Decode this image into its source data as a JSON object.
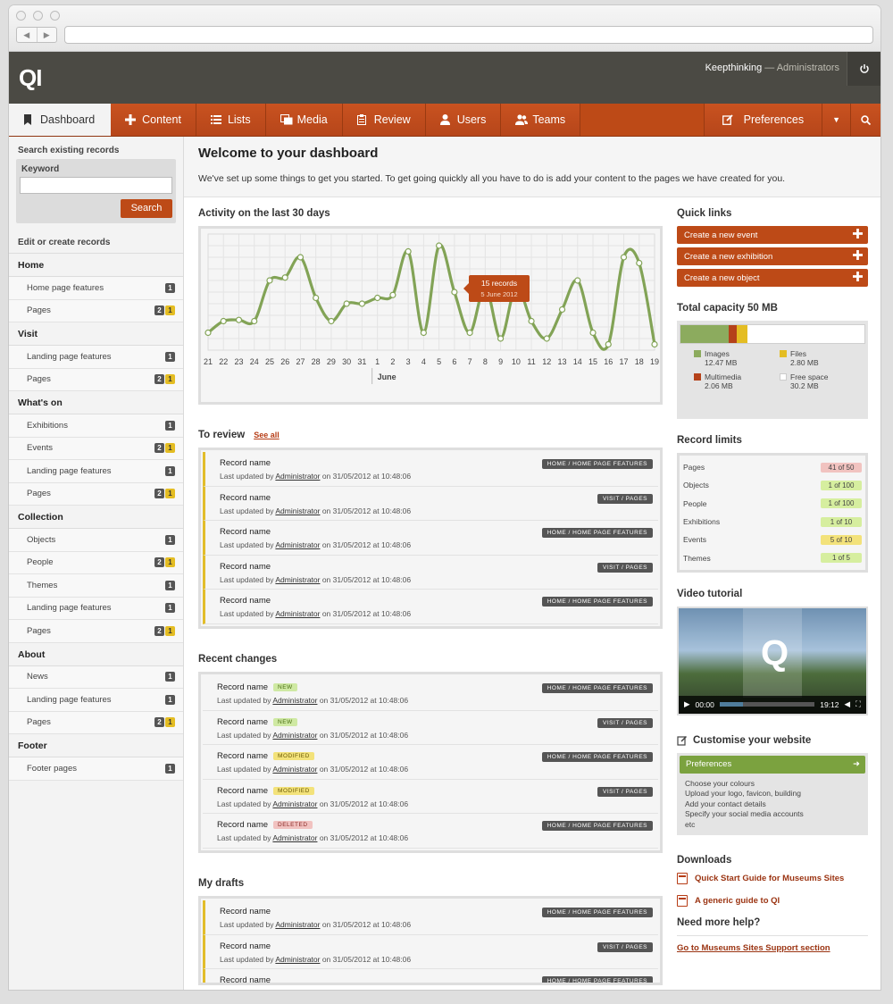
{
  "app": {
    "logo": "QI",
    "user_name": "Keepthinking",
    "user_sep": " — ",
    "user_role": "Administrators"
  },
  "nav": {
    "items": [
      {
        "label": "Dashboard",
        "icon": "bookmark-icon"
      },
      {
        "label": "Content",
        "icon": "plus-icon"
      },
      {
        "label": "Lists",
        "icon": "list-icon"
      },
      {
        "label": "Media",
        "icon": "media-icon"
      },
      {
        "label": "Review",
        "icon": "clipboard-icon"
      },
      {
        "label": "Users",
        "icon": "user-icon"
      },
      {
        "label": "Teams",
        "icon": "team-icon"
      }
    ],
    "preferences": "Preferences"
  },
  "sidebar": {
    "search_title": "Search existing records",
    "keyword_label": "Keyword",
    "keyword_value": "",
    "search_button": "Search",
    "edit_title": "Edit or create records",
    "groups": [
      {
        "title": "Home",
        "items": [
          {
            "label": "Home page features",
            "b1": "1",
            "b2": ""
          },
          {
            "label": "Pages",
            "b1": "2",
            "b2": "1"
          }
        ]
      },
      {
        "title": "Visit",
        "items": [
          {
            "label": "Landing page features",
            "b1": "1",
            "b2": ""
          },
          {
            "label": "Pages",
            "b1": "2",
            "b2": "1"
          }
        ]
      },
      {
        "title": "What's on",
        "items": [
          {
            "label": "Exhibitions",
            "b1": "1",
            "b2": ""
          },
          {
            "label": "Events",
            "b1": "2",
            "b2": "1"
          },
          {
            "label": "Landing page features",
            "b1": "1",
            "b2": ""
          },
          {
            "label": "Pages",
            "b1": "2",
            "b2": "1"
          }
        ]
      },
      {
        "title": "Collection",
        "items": [
          {
            "label": "Objects",
            "b1": "1",
            "b2": ""
          },
          {
            "label": "People",
            "b1": "2",
            "b2": "1"
          },
          {
            "label": "Themes",
            "b1": "1",
            "b2": ""
          },
          {
            "label": "Landing page features",
            "b1": "1",
            "b2": ""
          },
          {
            "label": "Pages",
            "b1": "2",
            "b2": "1"
          }
        ]
      },
      {
        "title": "About",
        "items": [
          {
            "label": "News",
            "b1": "1",
            "b2": ""
          },
          {
            "label": "Landing page features",
            "b1": "1",
            "b2": ""
          },
          {
            "label": "Pages",
            "b1": "2",
            "b2": "1"
          }
        ]
      },
      {
        "title": "Footer",
        "items": [
          {
            "label": "Footer pages",
            "b1": "1",
            "b2": ""
          }
        ]
      }
    ]
  },
  "welcome": {
    "title": "Welcome to your dashboard",
    "text": "We've set up some things to get you started. To get going quickly all you have to do is add your content to the pages we have created for you."
  },
  "activity": {
    "title": "Activity on the last 30 days",
    "tooltip_count": "15 records",
    "tooltip_date": "5 June 2012",
    "month_label": "June"
  },
  "chart_data": {
    "type": "line",
    "title": "Activity on the last 30 days",
    "x": [
      "21",
      "22",
      "23",
      "24",
      "25",
      "26",
      "27",
      "28",
      "29",
      "30",
      "31",
      "1",
      "2",
      "3",
      "4",
      "5",
      "6",
      "7",
      "8",
      "9",
      "10",
      "11",
      "12",
      "13",
      "14",
      "15",
      "16",
      "17",
      "18",
      "19"
    ],
    "values": [
      3,
      5,
      5.2,
      5,
      12,
      12.5,
      16,
      9,
      5,
      8,
      8,
      9,
      9.5,
      17,
      3,
      18,
      10,
      3,
      11,
      2,
      11,
      5,
      2,
      7,
      12,
      3,
      1,
      16,
      15,
      1
    ],
    "ylim": [
      0,
      20
    ],
    "grid": true,
    "highlight": {
      "x": "6",
      "label": "15 records",
      "date": "5 June 2012"
    }
  },
  "to_review": {
    "title": "To review",
    "see_all": "See all",
    "items": [
      {
        "name": "Record name",
        "prefix": "Last updated by ",
        "user": "Administrator",
        "suffix": " on 31/05/2012 at 10:48:06",
        "tag": "HOME / HOME PAGE FEATURES"
      },
      {
        "name": "Record name",
        "prefix": "Last updated by ",
        "user": "Administrator",
        "suffix": " on 31/05/2012 at 10:48:06",
        "tag": "VISIT / PAGES"
      },
      {
        "name": "Record name",
        "prefix": "Last updated by ",
        "user": "Administrator",
        "suffix": " on 31/05/2012 at 10:48:06",
        "tag": "HOME / HOME PAGE FEATURES"
      },
      {
        "name": "Record name",
        "prefix": "Last updated by ",
        "user": "Administrator",
        "suffix": " on 31/05/2012 at 10:48:06",
        "tag": "VISIT / PAGES"
      },
      {
        "name": "Record name",
        "prefix": "Last updated by ",
        "user": "Administrator",
        "suffix": " on 31/05/2012 at 10:48:06",
        "tag": "HOME / HOME PAGE FEATURES"
      }
    ]
  },
  "recent_changes": {
    "title": "Recent changes",
    "items": [
      {
        "name": "Record name",
        "status": "NEW",
        "status_class": "new",
        "prefix": "Last updated by ",
        "user": "Administrator",
        "suffix": " on 31/05/2012 at 10:48:06",
        "tag": "HOME / HOME PAGE FEATURES"
      },
      {
        "name": "Record name",
        "status": "NEW",
        "status_class": "new",
        "prefix": "Last updated by ",
        "user": "Administrator",
        "suffix": " on 31/05/2012 at 10:48:06",
        "tag": "VISIT / PAGES"
      },
      {
        "name": "Record name",
        "status": "MODIFIED",
        "status_class": "mod",
        "prefix": "Last updated by ",
        "user": "Administrator",
        "suffix": " on 31/05/2012 at 10:48:06",
        "tag": "HOME / HOME PAGE FEATURES"
      },
      {
        "name": "Record name",
        "status": "MODIFIED",
        "status_class": "mod",
        "prefix": "Last updated by ",
        "user": "Administrator",
        "suffix": " on 31/05/2012 at 10:48:06",
        "tag": "VISIT / PAGES"
      },
      {
        "name": "Record name",
        "status": "DELETED",
        "status_class": "del",
        "prefix": "Last updated by ",
        "user": "Administrator",
        "suffix": " on 31/05/2012 at 10:48:06",
        "tag": "HOME / HOME PAGE FEATURES"
      }
    ]
  },
  "my_drafts": {
    "title": "My drafts",
    "items": [
      {
        "name": "Record name",
        "prefix": "Last updated by ",
        "user": "Administrator",
        "suffix": " on 31/05/2012 at 10:48:06",
        "tag": "HOME / HOME PAGE FEATURES"
      },
      {
        "name": "Record name",
        "prefix": "Last updated by ",
        "user": "Administrator",
        "suffix": " on 31/05/2012 at 10:48:06",
        "tag": "VISIT / PAGES"
      },
      {
        "name": "Record name",
        "prefix": "",
        "user": "",
        "suffix": "",
        "tag": "HOME / HOME PAGE FEATURES"
      }
    ]
  },
  "quick_links": {
    "title": "Quick links",
    "items": [
      "Create a new event",
      "Create a new exhibition",
      "Create a new object"
    ]
  },
  "capacity": {
    "title": "Total capacity 50 MB",
    "segments": [
      {
        "name": "Images",
        "value": "12.47 MB",
        "mb": 12.47,
        "color": "#8cab5e"
      },
      {
        "name": "Multimedia",
        "value": "2.06 MB",
        "mb": 2.06,
        "color": "#b5421a"
      },
      {
        "name": "Files",
        "value": "2.80 MB",
        "mb": 2.8,
        "color": "#e4bd23"
      },
      {
        "name": "Free space",
        "value": "30.2 MB",
        "mb": 30.2,
        "color": "#ffffff"
      }
    ]
  },
  "record_limits": {
    "title": "Record limits",
    "items": [
      {
        "label": "Pages",
        "value": "41 of 50",
        "color": "#f1c3c0"
      },
      {
        "label": "Objects",
        "value": "1 of 100",
        "color": "#d6ee9f"
      },
      {
        "label": "People",
        "value": "1 of 100",
        "color": "#d6ee9f"
      },
      {
        "label": "Exhibitions",
        "value": "1 of 10",
        "color": "#d6ee9f"
      },
      {
        "label": "Events",
        "value": "5 of 10",
        "color": "#f3e27a"
      },
      {
        "label": "Themes",
        "value": "1 of 5",
        "color": "#d6ee9f"
      }
    ]
  },
  "video": {
    "title": "Video tutorial",
    "time_current": "00:00",
    "time_total": "19:12",
    "progress": 0.25
  },
  "customise": {
    "title": "Customise your website",
    "button": "Preferences",
    "lines": [
      "Choose your colours",
      "Upload your logo, favicon, building",
      "Add your contact details",
      "Specify your social media accounts",
      "etc"
    ]
  },
  "downloads": {
    "title": "Downloads",
    "items": [
      "Quick Start Guide for Museums Sites",
      "A generic guide to QI"
    ]
  },
  "help": {
    "title": "Need more help?",
    "link": "Go to Museums Sites Support section"
  }
}
